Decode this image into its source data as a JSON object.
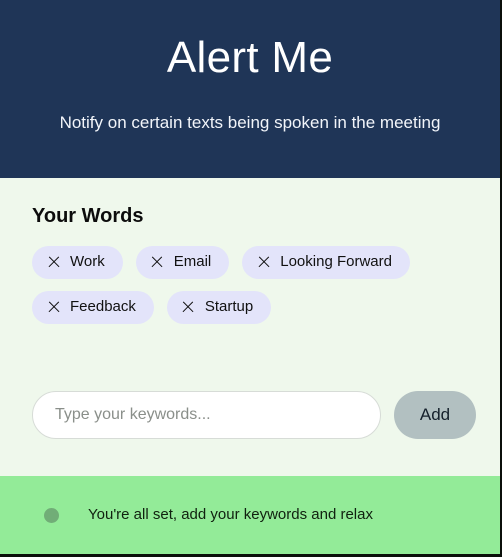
{
  "header": {
    "title": "Alert Me",
    "subtitle": "Notify on certain texts being spoken in the meeting",
    "background_color": "#1f3557",
    "title_color": "#ffffff"
  },
  "words_section": {
    "heading": "Your Words",
    "chip_background_color": "#e3e4fa",
    "remove_icon_name": "close-icon",
    "chips": [
      {
        "label": "Work"
      },
      {
        "label": "Email"
      },
      {
        "label": "Looking Forward"
      },
      {
        "label": "Feedback"
      },
      {
        "label": "Startup"
      }
    ]
  },
  "keyword_form": {
    "input_value": "",
    "input_placeholder": "Type your keywords...",
    "add_label": "Add",
    "add_background_color": "#b2c0c1"
  },
  "status": {
    "message": "You're all set, add your keywords and relax",
    "dot_color": "#71ad77",
    "background_color": "#93eb98"
  },
  "page": {
    "background_color": "#eff8ec"
  }
}
